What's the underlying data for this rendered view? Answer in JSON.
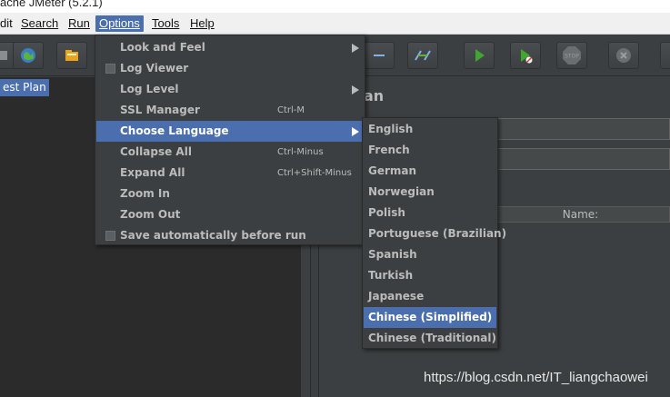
{
  "window": {
    "title_fragment": "ache JMeter (5.2.1)"
  },
  "menubar": {
    "items": [
      {
        "id": "edit",
        "label": "dit",
        "mnemonic": ""
      },
      {
        "id": "search",
        "label": "Search"
      },
      {
        "id": "run",
        "label": "Run"
      },
      {
        "id": "options",
        "label": "Options",
        "active": true
      },
      {
        "id": "tools",
        "label": "Tools"
      },
      {
        "id": "help",
        "label": "Help"
      }
    ]
  },
  "toolbar": {
    "buttons": [
      {
        "name": "clear-icon"
      },
      {
        "name": "templates-icon"
      },
      {
        "name": "open-icon"
      },
      {
        "name": "collapse-icon"
      },
      {
        "name": "toggle-icon"
      },
      {
        "name": "start-icon"
      },
      {
        "name": "start-no-timers-icon"
      },
      {
        "name": "stop-icon",
        "label": "STOP"
      },
      {
        "name": "shutdown-icon"
      },
      {
        "name": "more-icon"
      }
    ]
  },
  "tree": {
    "selected_item": "est Plan"
  },
  "content": {
    "title_fragment": "an",
    "table_header": "Name:"
  },
  "options_menu": {
    "items": [
      {
        "label": "Look and Feel",
        "shortcut": "",
        "submenu": true
      },
      {
        "label": "Log Viewer",
        "shortcut": "",
        "checkbox": true
      },
      {
        "label": "Log Level",
        "shortcut": "",
        "submenu": true
      },
      {
        "label": "SSL Manager",
        "shortcut": "Ctrl-M"
      },
      {
        "label": "Choose Language",
        "shortcut": "",
        "submenu": true,
        "highlighted": true
      },
      {
        "label": "Collapse All",
        "shortcut": "Ctrl-Minus"
      },
      {
        "label": "Expand All",
        "shortcut": "Ctrl+Shift-Minus"
      },
      {
        "label": "Zoom In",
        "shortcut": ""
      },
      {
        "label": "Zoom Out",
        "shortcut": ""
      },
      {
        "label": "Save automatically before run",
        "shortcut": "",
        "checkbox": true
      }
    ]
  },
  "language_menu": {
    "items": [
      {
        "label": "English"
      },
      {
        "label": "French"
      },
      {
        "label": "German"
      },
      {
        "label": "Norwegian"
      },
      {
        "label": "Polish"
      },
      {
        "label": "Portuguese (Brazilian)"
      },
      {
        "label": "Spanish"
      },
      {
        "label": "Turkish"
      },
      {
        "label": "Japanese"
      },
      {
        "label": "Chinese (Simplified)",
        "highlighted": true
      },
      {
        "label": "Chinese (Traditional)"
      }
    ]
  },
  "watermark": "https://blog.csdn.net/IT_liangchaowei",
  "colors": {
    "background": "#3c3f41",
    "tree_background": "#2b2b2b",
    "selection": "#4b6eaf",
    "text": "#bbbbbb",
    "run_green": "#3fa62e"
  }
}
